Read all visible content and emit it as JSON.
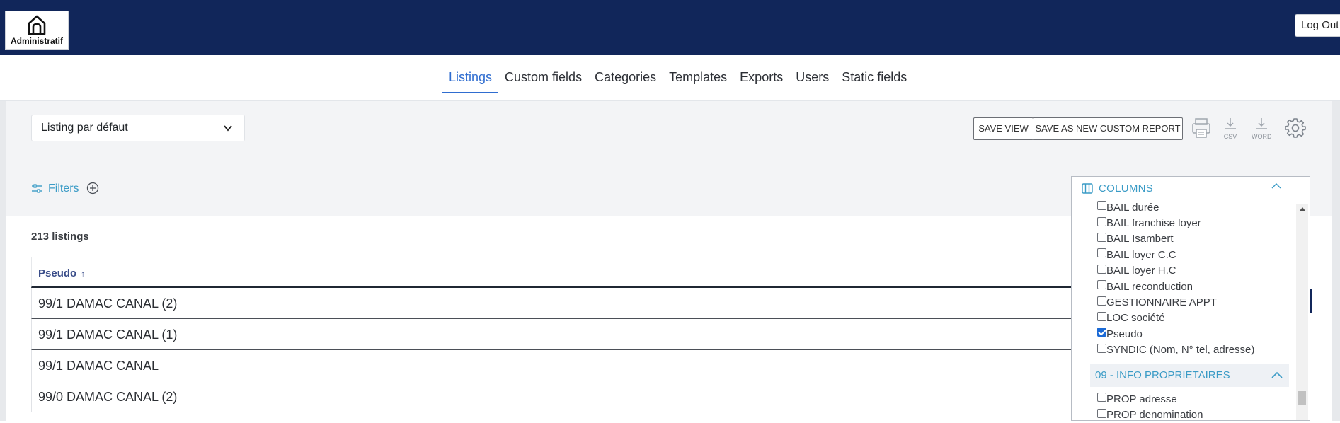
{
  "header": {
    "logo_text": "Administratif",
    "logout_label": "Log Out"
  },
  "nav": {
    "items": [
      {
        "label": "Listings",
        "active": true
      },
      {
        "label": "Custom fields"
      },
      {
        "label": "Categories"
      },
      {
        "label": "Templates"
      },
      {
        "label": "Exports"
      },
      {
        "label": "Users"
      },
      {
        "label": "Static fields"
      }
    ]
  },
  "toolbar": {
    "view_select": "Listing par défaut",
    "save_view": "SAVE VIEW",
    "save_custom_report": "SAVE AS NEW CUSTOM REPORT",
    "csv_caption": "CSV",
    "word_caption": "WORD",
    "icons": [
      "print-icon",
      "download-csv-icon",
      "download-word-icon",
      "gear-icon"
    ]
  },
  "filters": {
    "label": "Filters"
  },
  "listing": {
    "count_text": "213 listings",
    "column_header": "Pseudo",
    "sort_indicator": "↑",
    "rows": [
      "99/1 DAMAC CANAL (2)",
      "99/1 DAMAC CANAL (1)",
      "99/1 DAMAC CANAL",
      "99/0 DAMAC CANAL (2)"
    ]
  },
  "columns_panel": {
    "title": "COLUMNS",
    "items": [
      {
        "label": "BAIL durée",
        "checked": false
      },
      {
        "label": "BAIL franchise loyer",
        "checked": false
      },
      {
        "label": "BAIL Isambert",
        "checked": false
      },
      {
        "label": "BAIL loyer C.C",
        "checked": false
      },
      {
        "label": "BAIL loyer H.C",
        "checked": false
      },
      {
        "label": "BAIL reconduction",
        "checked": false
      },
      {
        "label": "GESTIONNAIRE APPT",
        "checked": false
      },
      {
        "label": "LOC société",
        "checked": false
      },
      {
        "label": "Pseudo",
        "checked": true
      },
      {
        "label": "SYNDIC (Nom, N° tel, adresse)",
        "checked": false
      }
    ],
    "group_title": "09 - INFO PROPRIETAIRES",
    "group_items": [
      {
        "label": "PROP adresse",
        "checked": false
      },
      {
        "label": "PROP denomination",
        "checked": false
      }
    ]
  },
  "colors": {
    "header_bg": "#11265a",
    "accent": "#2f6dd0",
    "link": "#3a9bc6"
  }
}
